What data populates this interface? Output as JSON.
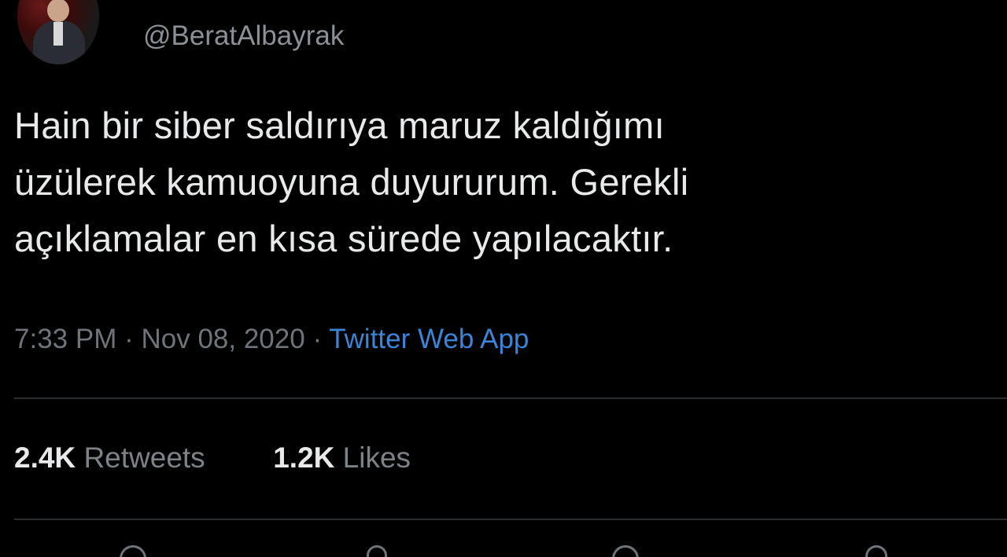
{
  "user": {
    "name_partial": "",
    "handle": "@BeratAlbayrak"
  },
  "tweet": {
    "lines": [
      "Hain bir siber saldırıya maruz kaldığımı",
      "üzülerek kamuoyuna duyururum. Gerekli",
      "açıklamalar en kısa sürede yapılacaktır."
    ],
    "time": "7:33 PM",
    "date": "Nov 08, 2020",
    "separator": "·",
    "source": "Twitter Web App"
  },
  "stats": {
    "retweets_count": "2.4K",
    "retweets_label": "Retweets",
    "likes_count": "1.2K",
    "likes_label": "Likes"
  },
  "actions": {
    "icons": [
      "reply-icon",
      "retweet-icon",
      "like-icon",
      "share-icon"
    ]
  },
  "colors": {
    "background": "#000000",
    "text": "#e7e9ea",
    "muted": "#6e7479",
    "link": "#3b84d6",
    "divider": "#2b2e31"
  }
}
